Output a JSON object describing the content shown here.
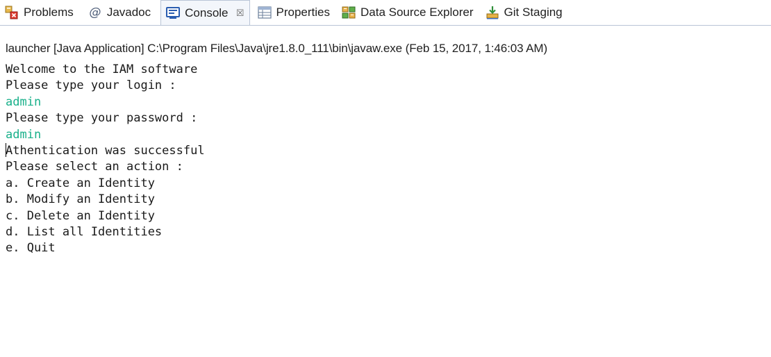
{
  "tabs": [
    {
      "label": "Problems",
      "icon": "problems-icon",
      "active": false
    },
    {
      "label": "Javadoc",
      "icon": "javadoc-at-icon",
      "active": false
    },
    {
      "label": "Console",
      "icon": "console-icon",
      "active": true,
      "close_glyph": "☒"
    },
    {
      "label": "Properties",
      "icon": "properties-icon",
      "active": false
    },
    {
      "label": "Data Source Explorer",
      "icon": "data-source-explorer-icon",
      "active": false
    },
    {
      "label": "Git Staging",
      "icon": "git-staging-icon",
      "active": false
    }
  ],
  "launch": {
    "description": "launcher [Java Application] C:\\Program Files\\Java\\jre1.8.0_111\\bin\\javaw.exe (Feb 15, 2017, 1:46:03 AM)"
  },
  "console": {
    "lines": [
      {
        "text": "Welcome to the IAM software",
        "type": "output"
      },
      {
        "text": "Please type your login :",
        "type": "output"
      },
      {
        "text": "admin",
        "type": "input"
      },
      {
        "text": "Please type your password :",
        "type": "output"
      },
      {
        "text": "admin",
        "type": "input"
      },
      {
        "text": "Athentication was successful",
        "type": "output",
        "caret": true
      },
      {
        "text": "Please select an action :",
        "type": "output"
      },
      {
        "text": "a. Create an Identity",
        "type": "output"
      },
      {
        "text": "b. Modify an Identity",
        "type": "output"
      },
      {
        "text": "c. Delete an Identity",
        "type": "output"
      },
      {
        "text": "d. List all Identities",
        "type": "output"
      },
      {
        "text": "e. Quit",
        "type": "output"
      }
    ]
  },
  "colors": {
    "input_text": "#18b08a",
    "output_text": "#1a1a1a",
    "active_tab_bg": "#f3f6fb",
    "tab_border": "#b9c4d6"
  }
}
